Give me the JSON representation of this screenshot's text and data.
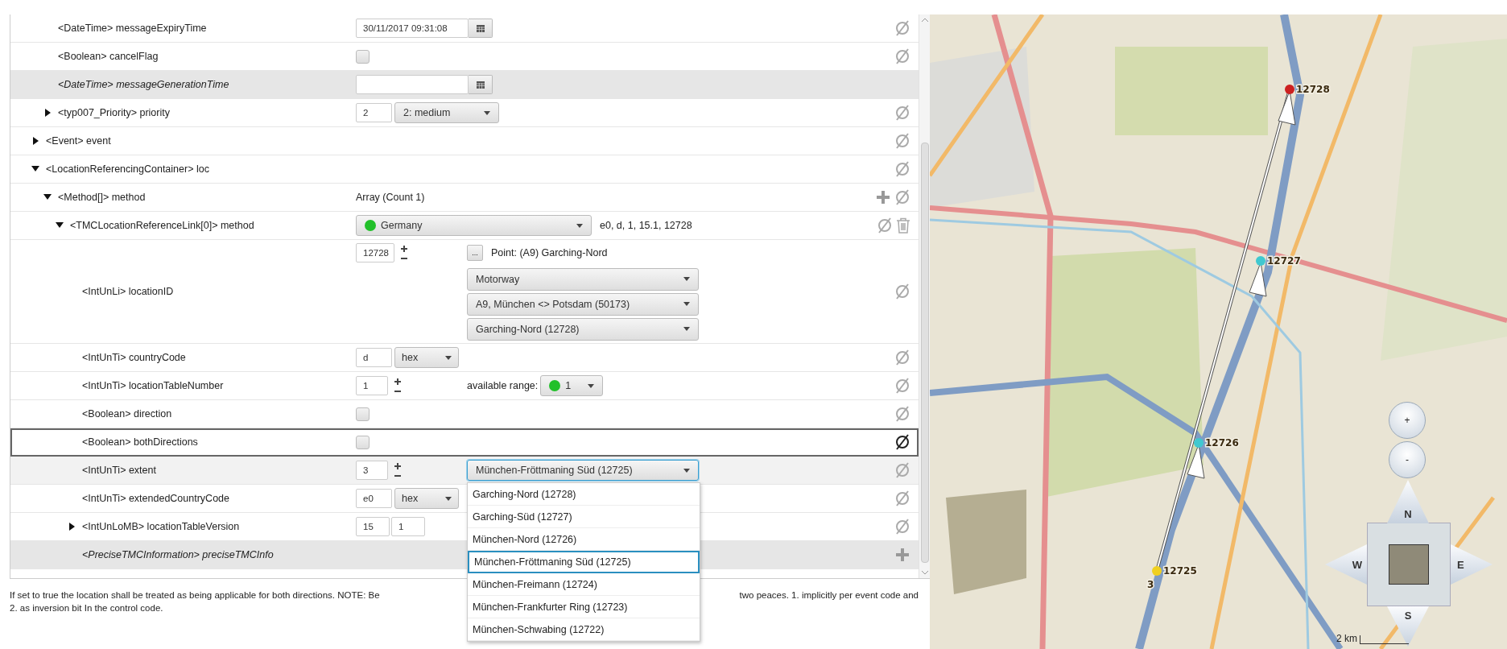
{
  "editor": {
    "parent_children": [
      {
        "label": "<DateTime> messageExpiryTime",
        "kind": "datetime",
        "unset": false,
        "focused": false,
        "hovered": false,
        "value": "30/11/2017 09:31:08",
        "clearable": true,
        "addable": false
      },
      {
        "label": "<Boolean> cancelFlag",
        "kind": "checkbox",
        "unset": false,
        "focused": false,
        "hovered": false,
        "checked": false,
        "clearable": true,
        "addable": false
      },
      {
        "label": "<DateTime> messageGenerationTime",
        "kind": "datetime",
        "unset": true,
        "focused": false,
        "hovered": false,
        "clearable": false,
        "addable": false
      },
      {
        "label": "<typ007_Priority> priority",
        "kind": "enum",
        "unset": false,
        "focused": false,
        "hovered": false,
        "expanded": false,
        "value": "2",
        "select": "2: medium",
        "clearable": true,
        "addable": false
      }
    ],
    "rows": [
      {
        "label": "<Event> event",
        "unset": false,
        "focused": false,
        "hovered": false,
        "expanded": false,
        "clearable": true,
        "addable": false
      },
      {
        "label": "<LocationReferencingContainer> loc",
        "unset": false,
        "focused": false,
        "hovered": false,
        "expanded": true,
        "clearable": true,
        "addable": false,
        "children": [
          {
            "label": "<Method[]> method",
            "kind": "text",
            "unset": false,
            "focused": false,
            "hovered": false,
            "expanded": true,
            "text": "Array (Count 1)",
            "clearable": true,
            "addable": true,
            "children": [
              {
                "label": "<TMCLocationReferenceLink[0]> method",
                "kind": "country",
                "unset": false,
                "focused": false,
                "hovered": false,
                "expanded": true,
                "select": "Germany",
                "color": "#22c02a",
                "summary": "e0, d, 1, 15.1, 12728",
                "clearable": true,
                "addable": false,
                "deletable": true,
                "children": [
                  {
                    "label": "<IntUnLi> locationID",
                    "kind": "location",
                    "unset": false,
                    "focused": false,
                    "hovered": false,
                    "value": "12728",
                    "browse": "...",
                    "point": "Point: (A9) Garching-Nord",
                    "selects": [
                      "Motorway",
                      "A9, München <> Potsdam (50173)",
                      "Garching-Nord (12728)"
                    ],
                    "clearable": true,
                    "addable": false
                  },
                  {
                    "label": "<IntUnTi> countryCode",
                    "kind": "hex",
                    "unset": false,
                    "focused": false,
                    "hovered": false,
                    "value": "d",
                    "select": "hex",
                    "clearable": true,
                    "addable": false
                  },
                  {
                    "label": "<IntUnTi> locationTableNumber",
                    "kind": "range",
                    "unset": false,
                    "focused": false,
                    "hovered": false,
                    "value": "1",
                    "range_label": "available range:",
                    "select": "1",
                    "color": "#22c02a",
                    "clearable": true,
                    "addable": false
                  },
                  {
                    "label": "<Boolean> direction",
                    "kind": "checkbox",
                    "unset": false,
                    "focused": false,
                    "hovered": false,
                    "checked": false,
                    "clearable": true,
                    "addable": false
                  },
                  {
                    "label": "<Boolean> bothDirections",
                    "kind": "checkbox",
                    "unset": false,
                    "focused": true,
                    "hovered": false,
                    "checked": false,
                    "clearable": true,
                    "addable": false
                  },
                  {
                    "label": "<IntUnTi> extent",
                    "kind": "extent",
                    "unset": false,
                    "focused": false,
                    "hovered": true,
                    "value": "3",
                    "select": "München-Fröttmaning Süd (12725)",
                    "open": true,
                    "options": [
                      {
                        "label": "Garching-Nord (12728)",
                        "selected": false
                      },
                      {
                        "label": "Garching-Süd (12727)",
                        "selected": false
                      },
                      {
                        "label": "München-Nord (12726)",
                        "selected": false
                      },
                      {
                        "label": "München-Fröttmaning Süd (12725)",
                        "selected": true
                      },
                      {
                        "label": "München-Freimann (12724)",
                        "selected": false
                      },
                      {
                        "label": "München-Frankfurter Ring (12723)",
                        "selected": false
                      },
                      {
                        "label": "München-Schwabing (12722)",
                        "selected": false
                      }
                    ],
                    "clearable": true,
                    "addable": false
                  },
                  {
                    "label": "<IntUnTi> extendedCountryCode",
                    "kind": "hex",
                    "unset": false,
                    "focused": false,
                    "hovered": false,
                    "value": "e0",
                    "select": "hex",
                    "clearable": true,
                    "addable": false
                  },
                  {
                    "label": "<IntUnLoMB> locationTableVersion",
                    "kind": "pair",
                    "unset": false,
                    "focused": false,
                    "hovered": false,
                    "expanded": false,
                    "values": [
                      "15",
                      "1"
                    ],
                    "clearable": true,
                    "addable": false
                  },
                  {
                    "label": "<PreciseTMCInformation> preciseTMCInfo",
                    "unset": true,
                    "focused": false,
                    "hovered": false,
                    "clearable": false,
                    "addable": true
                  }
                ]
              }
            ]
          }
        ]
      }
    ],
    "description": {
      "line_1_start": "If set to true the location shall be treated as being applicable for both directions. NOTE: Be",
      "line_1_end": "two peaces. 1. implicitly per event code and",
      "line_2": "2. as inversion bit In the control code."
    }
  },
  "map": {
    "markers": [
      {
        "label": "12728",
        "color": "#cc2020"
      },
      {
        "label": "12727",
        "color": "#40c8d0"
      },
      {
        "label": "12726",
        "color": "#40c8d0"
      },
      {
        "label": "12725",
        "color": "#f0d020"
      }
    ],
    "extent_label": "3",
    "zoom_in": "+",
    "zoom_out": "-",
    "pan": {
      "north": "N",
      "west": "W",
      "east": "E",
      "south": "S"
    },
    "scale": "2 km"
  }
}
